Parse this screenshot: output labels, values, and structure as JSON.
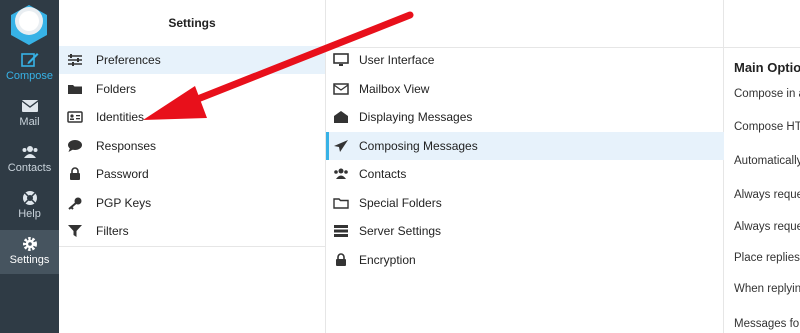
{
  "nav": {
    "items": [
      {
        "label": "Compose",
        "icon": "edit-icon"
      },
      {
        "label": "Mail",
        "icon": "envelope-icon"
      },
      {
        "label": "Contacts",
        "icon": "users-icon"
      },
      {
        "label": "Help",
        "icon": "lifebuoy-icon"
      },
      {
        "label": "Settings",
        "icon": "gear-icon"
      }
    ]
  },
  "settings": {
    "title": "Settings",
    "items": [
      {
        "label": "Preferences"
      },
      {
        "label": "Folders"
      },
      {
        "label": "Identities"
      },
      {
        "label": "Responses"
      },
      {
        "label": "Password"
      },
      {
        "label": "PGP Keys"
      },
      {
        "label": "Filters"
      }
    ]
  },
  "sections": {
    "items": [
      {
        "label": "User Interface"
      },
      {
        "label": "Mailbox View"
      },
      {
        "label": "Displaying Messages"
      },
      {
        "label": "Composing Messages"
      },
      {
        "label": "Contacts"
      },
      {
        "label": "Special Folders"
      },
      {
        "label": "Server Settings"
      },
      {
        "label": "Encryption"
      }
    ]
  },
  "main": {
    "title": "Main Optio",
    "options": [
      "Compose in a",
      "Compose HTM",
      "Automatically",
      "Always reque",
      "Always reque",
      "Place replies i",
      "When replying",
      "Messages for"
    ]
  },
  "colors": {
    "nav_bg": "#2f3b45",
    "accent": "#37b2e6",
    "selected_bg": "#e7f2fb",
    "arrow": "#e8101b"
  }
}
